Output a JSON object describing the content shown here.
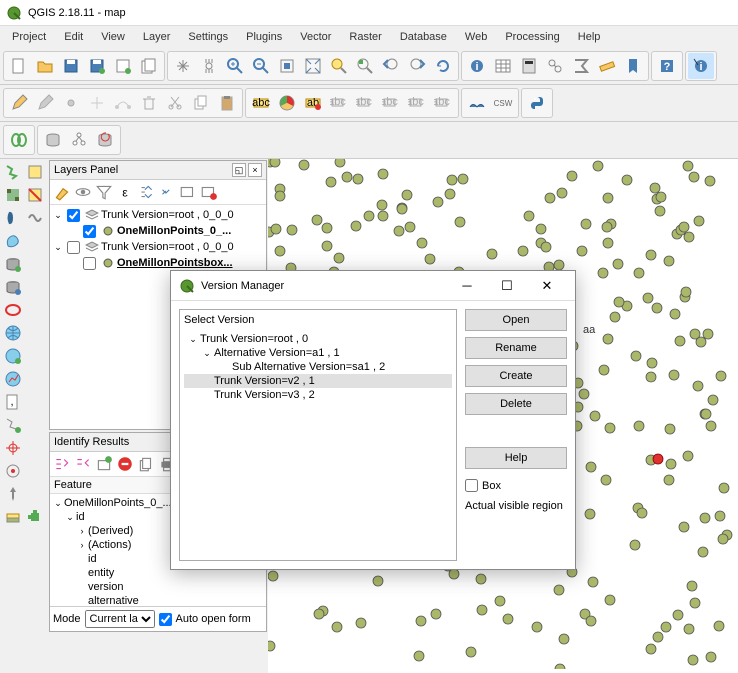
{
  "window": {
    "title": "QGIS 2.18.11 - map"
  },
  "menu": {
    "project": "Project",
    "edit": "Edit",
    "view": "View",
    "layer": "Layer",
    "settings": "Settings",
    "plugins": "Plugins",
    "vector": "Vector",
    "raster": "Raster",
    "database": "Database",
    "web": "Web",
    "processing": "Processing",
    "help": "Help"
  },
  "layers_panel": {
    "title": "Layers Panel",
    "item1": "Trunk Version=root , 0_0_0",
    "item1a": "OneMillonPoints_0_...",
    "item2": "Trunk Version=root , 0_0_0",
    "item2a": "OneMillonPointsbox..."
  },
  "identify": {
    "title": "Identify Results",
    "feature": "Feature",
    "root": "OneMillonPoints_0_...",
    "id": "id",
    "derived": "(Derived)",
    "actions": "(Actions)",
    "f_id": "id",
    "f_entity": "entity",
    "f_version": "version",
    "f_alt": "alternative",
    "mode_label": "Mode",
    "mode_value": "Current la",
    "auto_open": "Auto open form"
  },
  "version_dialog": {
    "title": "Version Manager",
    "select": "Select Version",
    "v_root": "Trunk Version=root , 0",
    "v_a1": "Alternative Version=a1 , 1",
    "v_sa1": "Sub Alternative Version=sa1 , 2",
    "v_v2": "Trunk Version=v2 , 1",
    "v_v3": "Trunk Version=v3 , 2",
    "btn_open": "Open",
    "btn_rename": "Rename",
    "btn_create": "Create",
    "btn_delete": "Delete",
    "btn_help": "Help",
    "box": "Box",
    "region": "Actual visible region"
  },
  "aa_label": "aa"
}
